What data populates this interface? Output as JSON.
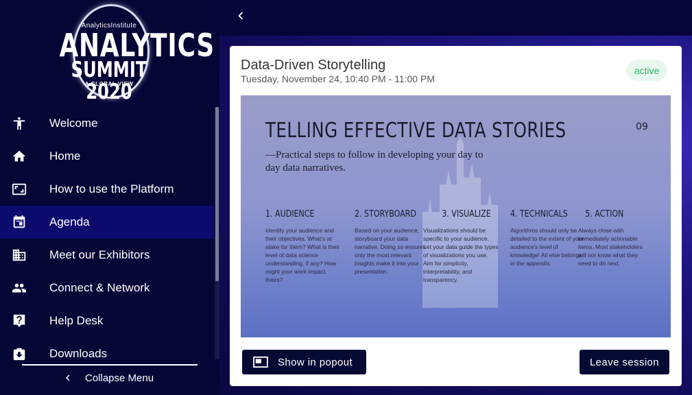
{
  "logo": {
    "small": "AnalyticsInstitute",
    "line1": "ANALYTICS",
    "line2": "SUMMIT 2020",
    "tagline": "A GLOBAL VIEW"
  },
  "sidebar": {
    "items": [
      {
        "label": "Welcome",
        "icon": "accessibility-icon",
        "active": false
      },
      {
        "label": "Home",
        "icon": "home-icon",
        "active": false
      },
      {
        "label": "How to use the Platform",
        "icon": "aspect-ratio-icon",
        "active": false
      },
      {
        "label": "Agenda",
        "icon": "calendar-icon",
        "active": true
      },
      {
        "label": "Meet our Exhibitors",
        "icon": "building-icon",
        "active": false
      },
      {
        "label": "Connect & Network",
        "icon": "people-icon",
        "active": false
      },
      {
        "label": "Help Desk",
        "icon": "help-icon",
        "active": false
      },
      {
        "label": "Downloads",
        "icon": "download-box-icon",
        "active": false
      }
    ],
    "collapse_label": "Collapse Menu"
  },
  "session": {
    "title": "Data-Driven Storytelling",
    "datetime": "Tuesday, November 24, 10:40 PM - 11:00 PM",
    "status": "active",
    "status_color": "#2fb36a"
  },
  "slide": {
    "title": "TELLING EFFECTIVE DATA STORIES",
    "number": "09",
    "subtitle": "—Practical steps to follow in developing your day to day data narratives.",
    "steps": [
      {
        "head": "1. AUDIENCE",
        "body": "Identify your audience and their objectives. What's at stake for them? What is their level of data science understanding, if any? How might your work impact theirs?"
      },
      {
        "head": "2. STORYBOARD",
        "body": "Based on your audience, storyboard your data narrative. Doing so ensures only the most relevant insights make it into your presentation."
      },
      {
        "head": "3. VISUALIZE",
        "body": "Visualizations should be specific to your audience. Let your data guide the types of visualizations you use. Aim for simplicity, interpretability, and transparency."
      },
      {
        "head": "4. TECHNICALS",
        "body": "Algorithms should only be detailed to the extent of your audience's level of knowledge! All else belongs in the appendix."
      },
      {
        "head": "5. ACTION",
        "body": "Always close with immediately actionable items. Most stakeholders will not know what they need to do next."
      }
    ]
  },
  "buttons": {
    "popout": "Show in popout",
    "leave": "Leave session"
  },
  "colors": {
    "sidebar_bg": "#050536",
    "active_item_bg": "#0d0a6e",
    "button_bg": "#060a33"
  }
}
